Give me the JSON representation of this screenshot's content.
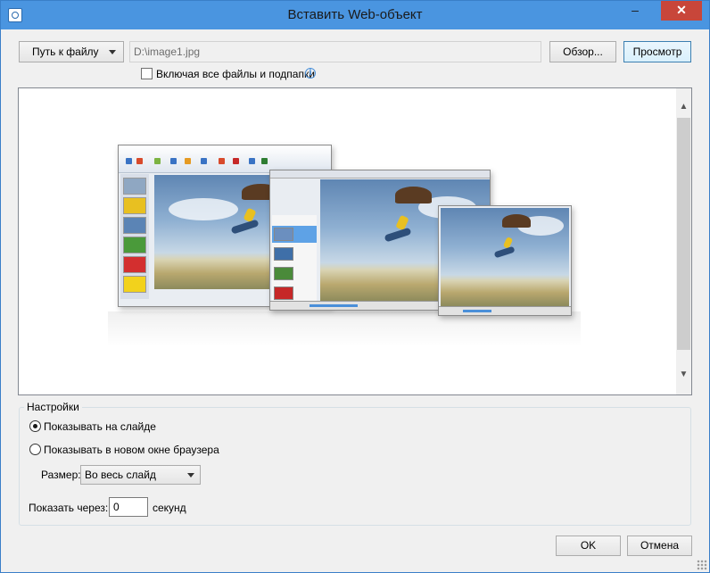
{
  "window": {
    "title": "Вставить Web-объект",
    "minimize_glyph": "–",
    "close_glyph": "✕"
  },
  "source": {
    "type_selected": "Путь к файлу",
    "path_value": "D:\\image1.jpg",
    "browse_label": "Обзор...",
    "preview_label": "Просмотр",
    "include_subfolders_label": "Включая все файлы и подпапки",
    "include_subfolders_checked": false
  },
  "preview": {
    "image": "powerpoint-photo-collage",
    "scroll_up_glyph": "▲",
    "scroll_down_glyph": "▼"
  },
  "settings": {
    "group_label": "Настройки",
    "show_on_slide_label": "Показывать на слайде",
    "show_in_browser_label": "Показывать в новом окне браузера",
    "selected_display": "show_on_slide",
    "size_label": "Размер:",
    "size_value": "Во весь слайд",
    "delay_label": "Показать через:",
    "delay_value": "0",
    "delay_unit": "секунд"
  },
  "footer": {
    "ok_label": "OK",
    "cancel_label": "Отмена"
  },
  "colors": {
    "titlebar": "#4a95e0",
    "close_button": "#c8463a",
    "dialog_bg": "#f0f0f0"
  }
}
